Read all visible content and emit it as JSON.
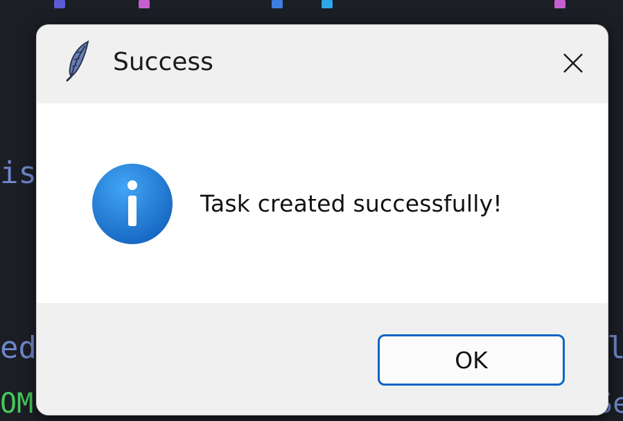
{
  "dialog": {
    "title": "Success",
    "icon": "feather-icon",
    "close_icon": "close-icon",
    "message_icon": "info-icon",
    "message": "Task created successfully!",
    "ok_label": "OK"
  },
  "background": {
    "fragments": [
      "is",
      "ed",
      "lo",
      "OM",
      "Se"
    ]
  },
  "colors": {
    "dialog_bg": "#f0f0f0",
    "content_bg": "#ffffff",
    "button_border": "#0a64c4",
    "info_blue": "#1e88e5",
    "backdrop": "#1b1e25"
  }
}
